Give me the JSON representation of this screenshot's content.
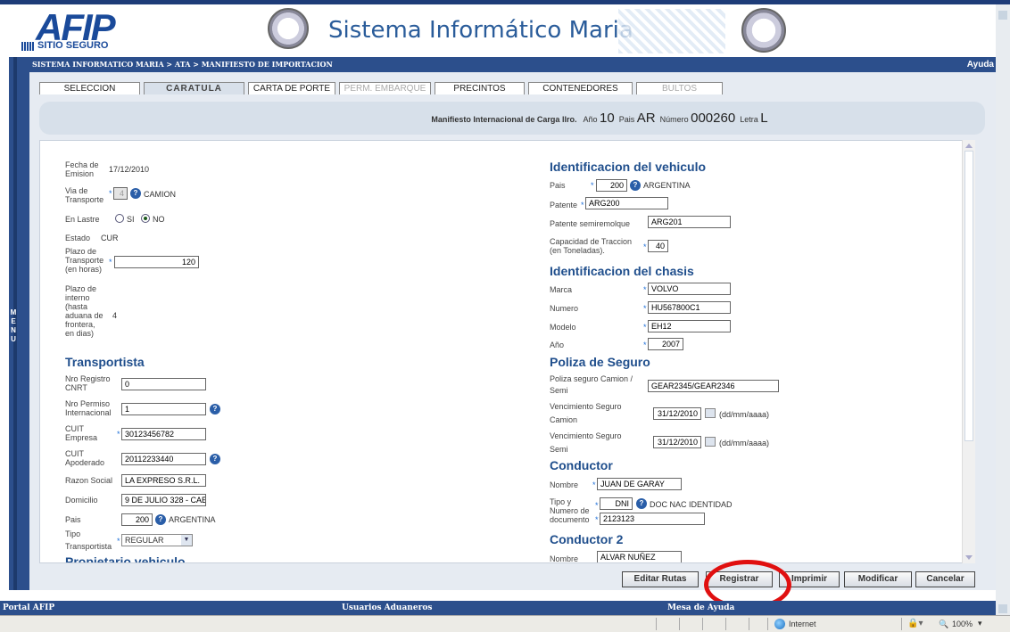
{
  "banner": {
    "logo_text": "AFIP",
    "logo_sub": "SITIO SEGURO",
    "title": "Sistema Informático Maria"
  },
  "breadcrumb": "SISTEMA INFORMATICO MARIA > ATA > MANIFIESTO DE IMPORTACION",
  "help_link": "Ayuda",
  "side_menu_label": [
    "M",
    "E",
    "N",
    "U"
  ],
  "tabs": [
    {
      "label": "SELECCION",
      "state": "normal"
    },
    {
      "label": "CARATULA",
      "state": "active"
    },
    {
      "label": "CARTA DE PORTE",
      "state": "normal"
    },
    {
      "label": "PERM. EMBARQUE",
      "state": "disabled"
    },
    {
      "label": "PRECINTOS",
      "state": "normal"
    },
    {
      "label": "CONTENEDORES",
      "state": "normal"
    },
    {
      "label": "BULTOS",
      "state": "disabled"
    }
  ],
  "manifest_header": {
    "title": "Manifiesto Internacional de Carga llro.",
    "anio_label": "Año",
    "anio": "10",
    "pais_label": "Pais",
    "pais": "AR",
    "numero_label": "Número",
    "numero": "000260",
    "letra_label": "Letra",
    "letra": "L"
  },
  "left": {
    "fecha_emision_label": [
      "Fecha de",
      "Emision"
    ],
    "fecha_emision": "17/12/2010",
    "via_label": [
      "Via de",
      "Transporte"
    ],
    "via_code": "4",
    "via_desc": "CAMION",
    "lastre_label": "En Lastre",
    "lastre_si": "SI",
    "lastre_no": "NO",
    "estado_label": "Estado",
    "estado": "CUR",
    "plazo_transporte_label": [
      "Plazo de",
      "Transporte",
      "(en horas)"
    ],
    "plazo_transporte": "120",
    "plazo_interno_label": [
      "Plazo de",
      "interno",
      "(hasta",
      "aduana de",
      "frontera,",
      "en dias)"
    ],
    "plazo_interno": "4",
    "transportista_title": "Transportista",
    "nro_registro_label": [
      "Nro Registro",
      "CNRT"
    ],
    "nro_registro": "0",
    "nro_permiso_label": [
      "Nro Permiso",
      "Internacional"
    ],
    "nro_permiso": "1",
    "cuit_empresa_label": [
      "CUIT",
      "Empresa"
    ],
    "cuit_empresa": "30123456782",
    "cuit_apoderado_label": [
      "CUIT",
      "Apoderado"
    ],
    "cuit_apoderado": "20112233440",
    "razon_social_label": "Razon Social",
    "razon_social": "LA EXPRESO S.R.L.",
    "domicilio_label": "Domicilio",
    "domicilio": "9 DE JULIO 328 - CAE",
    "pais_label": "Pais",
    "pais_code": "200",
    "pais_desc": "ARGENTINA",
    "tipo_transportista_label": [
      "Tipo",
      "Transportista"
    ],
    "tipo_transportista": "REGULAR",
    "propietario_title": "Propietario vehiculo"
  },
  "right": {
    "vehiculo_title": "Identificacion del vehiculo",
    "pais_label": "Pais",
    "pais_code": "200",
    "pais_desc": "ARGENTINA",
    "patente_label": "Patente",
    "patente": "ARG200",
    "semiremolque_label": "Patente semiremolque",
    "semiremolque": "ARG201",
    "capacidad_label": [
      "Capacidad de Traccion",
      "(en Toneladas)."
    ],
    "capacidad": "40",
    "chasis_title": "Identificacion del chasis",
    "marca_label": "Marca",
    "marca": "VOLVO",
    "numero_label": "Numero",
    "numero": "HU567800C1",
    "modelo_label": "Modelo",
    "modelo": "EH12",
    "anio_label": "Año",
    "anio": "2007",
    "poliza_title": "Poliza de Seguro",
    "poliza_label": [
      "Poliza seguro Camion /",
      "Semi"
    ],
    "poliza": "GEAR2345/GEAR2346",
    "venc_camion_label": [
      "Vencimiento Seguro",
      "Camion"
    ],
    "venc_camion": "31/12/2010",
    "venc_semi_label": [
      "Vencimiento Seguro",
      "Semi"
    ],
    "venc_semi": "31/12/2010",
    "date_hint": "(dd/mm/aaaa)",
    "conductor_title": "Conductor",
    "nombre_label": "Nombre",
    "nombre": "JUAN DE GARAY",
    "tipo_doc_label": [
      "Tipo y",
      "Numero de",
      "documento"
    ],
    "tipo_doc": "DNI",
    "tipo_doc_desc": "DOC NAC IDENTIDAD",
    "documento": "2123123",
    "conductor2_title": "Conductor 2",
    "nombre2_label": "Nombre",
    "nombre2": "ALVAR NUÑEZ"
  },
  "actions": {
    "editar_rutas": "Editar Rutas",
    "registrar": "Registrar",
    "imprimir": "Imprimir",
    "modificar": "Modificar",
    "cancelar": "Cancelar"
  },
  "footer": {
    "portal": "Portal AFIP",
    "usuarios": "Usuarios Aduaneros",
    "mesa": "Mesa de Ayuda"
  },
  "statusbar": {
    "zone": "Internet",
    "zoom": "100%"
  },
  "colors": {
    "navy": "#2c4f8c",
    "section_blue": "#1f4e8c",
    "highlight_red": "#e01010"
  }
}
